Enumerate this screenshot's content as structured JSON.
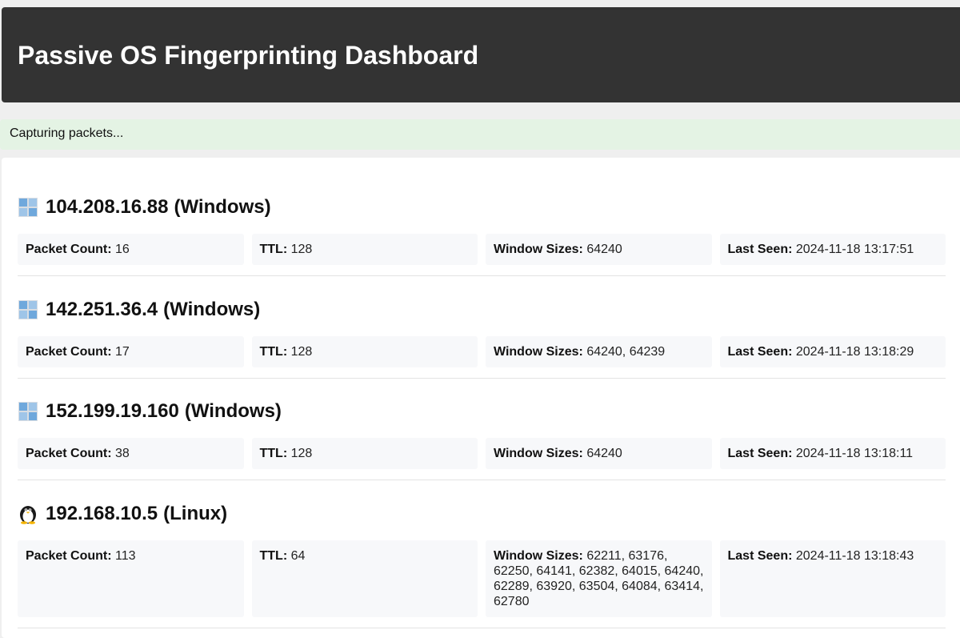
{
  "header": {
    "title": "Passive OS Fingerprinting Dashboard"
  },
  "status": {
    "text": "Capturing packets..."
  },
  "labels": {
    "packet_count": "Packet Count:",
    "ttl": "TTL:",
    "window_sizes": "Window Sizes:",
    "last_seen": "Last Seen:"
  },
  "hosts": [
    {
      "ip": "104.208.16.88",
      "os": "(Windows)",
      "icon": "windows-icon",
      "packet_count": "16",
      "ttl": "128",
      "window_sizes": "64240",
      "last_seen": "2024-11-18 13:17:51"
    },
    {
      "ip": "142.251.36.4",
      "os": "(Windows)",
      "icon": "windows-icon",
      "packet_count": "17",
      "ttl": "128",
      "window_sizes": "64240, 64239",
      "last_seen": "2024-11-18 13:18:29"
    },
    {
      "ip": "152.199.19.160",
      "os": "(Windows)",
      "icon": "windows-icon",
      "packet_count": "38",
      "ttl": "128",
      "window_sizes": "64240",
      "last_seen": "2024-11-18 13:18:11"
    },
    {
      "ip": "192.168.10.5",
      "os": "(Linux)",
      "icon": "linux-penguin-icon",
      "packet_count": "113",
      "ttl": "64",
      "window_sizes": "62211, 63176, 62250, 64141, 62382, 64015, 64240, 62289, 63920, 63504, 64084, 63414, 62780",
      "last_seen": "2024-11-18 13:18:43"
    }
  ]
}
